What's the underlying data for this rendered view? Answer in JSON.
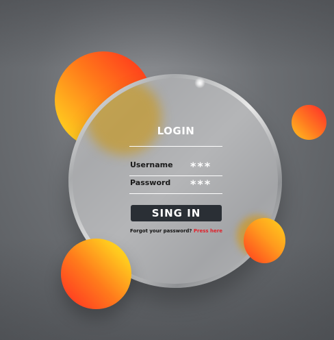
{
  "colors": {
    "accent_orange": "#ff7a1a",
    "accent_red": "#ff2a1e",
    "accent_yellow": "#ffd21f",
    "button_bg": "#2a2f35",
    "link_red": "#e0202a"
  },
  "login": {
    "title": "LOGIN",
    "username_label": "Username",
    "username_value": "***",
    "password_label": "Password",
    "password_value": "***",
    "submit_label": "SING IN",
    "forgot_text": "Forgot your password?",
    "forgot_link": "Press here"
  }
}
